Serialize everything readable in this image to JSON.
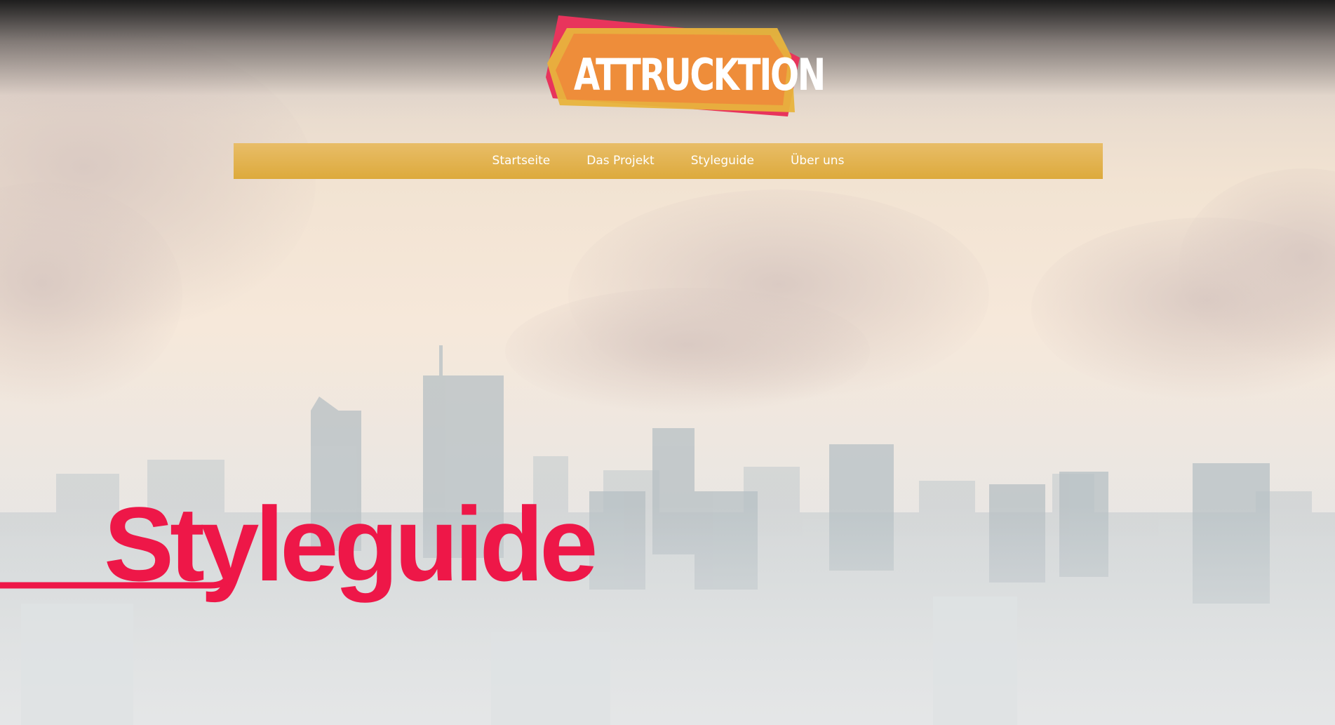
{
  "brand": {
    "logo_text": "ATTRUCKTION"
  },
  "nav": {
    "items": [
      {
        "label": "Startseite"
      },
      {
        "label": "Das Projekt"
      },
      {
        "label": "Styleguide"
      },
      {
        "label": "Über uns"
      }
    ]
  },
  "hero": {
    "title": "Styleguide"
  },
  "colors": {
    "accent": "#ee1748",
    "nav_background": "#ddaa3c",
    "logo_orange": "#ee8a3a",
    "logo_yellow": "#e8b43c",
    "logo_pink": "#e8345c"
  }
}
